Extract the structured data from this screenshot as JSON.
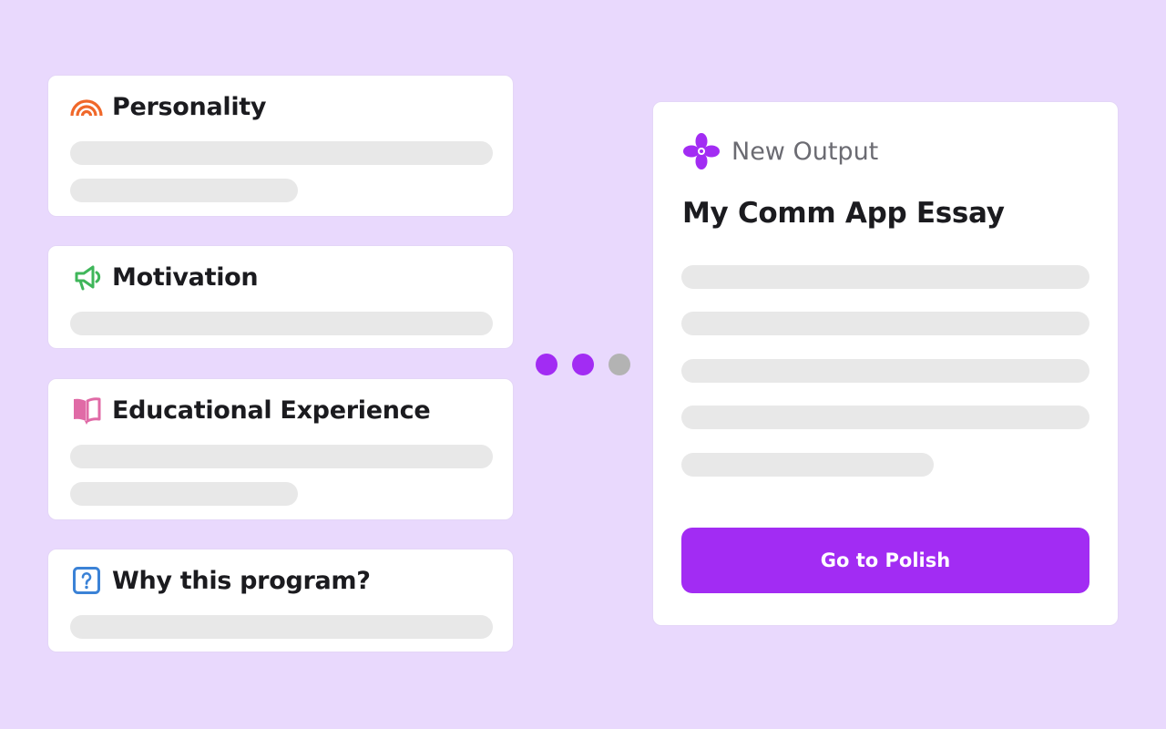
{
  "colors": {
    "background": "#e9d9fd",
    "card": "#ffffff",
    "placeholder_bar": "#e8e8e8",
    "accent": "#a22cf3",
    "dot_active": "#a22cf3",
    "dot_inactive": "#b3b3b3",
    "personality_icon": "#f0682a",
    "motivation_icon": "#3fb65a",
    "education_icon": "#e06aa6",
    "question_icon": "#3b82d6"
  },
  "input_cards": [
    {
      "title": "Personality",
      "icon": "rainbow-icon"
    },
    {
      "title": "Motivation",
      "icon": "megaphone-icon"
    },
    {
      "title": "Educational Experience",
      "icon": "book-icon"
    },
    {
      "title": "Why this program?",
      "icon": "question-icon"
    }
  ],
  "progress": {
    "total_steps": 3,
    "active_steps": 2
  },
  "output": {
    "header": "New Output",
    "header_icon": "flower-logo-icon",
    "title": "My Comm App Essay",
    "button_label": "Go to Polish"
  }
}
